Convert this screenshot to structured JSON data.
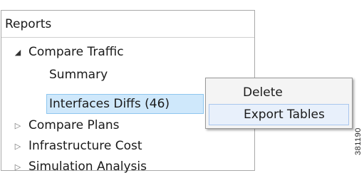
{
  "panel": {
    "title": "Reports",
    "tree": [
      {
        "label": "Compare Traffic",
        "state": "expanded",
        "icon": "expanded-triangle-icon"
      },
      {
        "label": "Summary",
        "state": "child"
      },
      {
        "label": "Interfaces Diffs (46)",
        "state": "child-selected"
      },
      {
        "label": "Compare Plans",
        "state": "collapsed",
        "icon": "collapsed-triangle-icon"
      },
      {
        "label": "Infrastructure Cost",
        "state": "collapsed",
        "icon": "collapsed-triangle-icon"
      },
      {
        "label": "Simulation Analysis",
        "state": "collapsed",
        "icon": "collapsed-triangle-icon"
      }
    ]
  },
  "context_menu": {
    "items": [
      {
        "label": "Delete"
      },
      {
        "label": "Export Tables"
      }
    ]
  },
  "side_code": "381190",
  "colors": {
    "selection_fill": "#cfe8fb",
    "selection_border": "#8ec6ef",
    "menu_hover_fill": "#e8f0fb",
    "menu_hover_border": "#a9c6ee"
  }
}
